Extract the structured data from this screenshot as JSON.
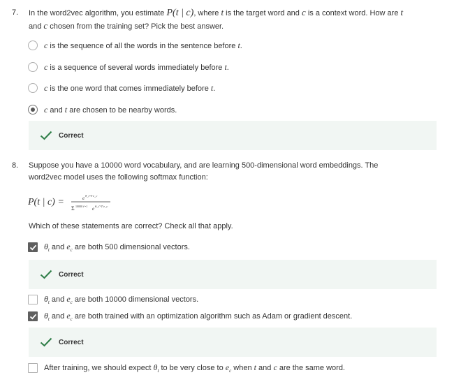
{
  "q7": {
    "number": "7.",
    "text_a": "In the word2vec algorithm, you estimate ",
    "text_math": "P(t | c)",
    "text_b": ", where ",
    "t1": "t",
    "text_c": " is the target word and ",
    "c1": "c",
    "text_d": " is a context word. How are ",
    "t2": "t",
    "text_e": "and ",
    "c2": "c",
    "text_f": " chosen from the training set? Pick the best answer.",
    "options": [
      {
        "pre": "c",
        "text": " is the sequence of all the words in the sentence before ",
        "post": "t",
        "end": "."
      },
      {
        "pre": "c",
        "text": " is a sequence of several words immediately before ",
        "post": "t",
        "end": "."
      },
      {
        "pre": "c",
        "text": " is the one word that comes immediately before ",
        "post": "t",
        "end": "."
      },
      {
        "pre": "c",
        "text": " and ",
        "post": "t",
        "end": " are chosen to be nearby words."
      }
    ],
    "feedback": "Correct"
  },
  "q8": {
    "number": "8.",
    "text_a": "Suppose you have a 10000 word vocabulary, and are learning 500-dimensional word embeddings. The",
    "text_b": "word2vec model uses the following softmax function:",
    "formula_lhs": "P(t | c) =",
    "formula_num": "e",
    "formula_num_sup": "θ_t^T e_c",
    "formula_den": "Σ",
    "formula_den_limits": "10000 t′=1",
    "formula_den_e": "e",
    "formula_den_sup": "θ_t′^T e_c",
    "prompt": "Which of these statements are correct? Check all that apply.",
    "options": [
      {
        "theta": "θ",
        "tsub": "t",
        "and": " and ",
        "e": "e",
        "csub": "c",
        "rest": " are both 500 dimensional vectors."
      },
      {
        "theta": "θ",
        "tsub": "t",
        "and": " and ",
        "e": "e",
        "csub": "c",
        "rest": " are both 10000 dimensional vectors."
      },
      {
        "theta": "θ",
        "tsub": "t",
        "and": " and ",
        "e": "e",
        "csub": "c",
        "rest": " are both trained with an optimization algorithm such as Adam or gradient descent."
      },
      {
        "pre": "After training, we should expect ",
        "theta": "θ",
        "tsub": "t",
        "mid": " to be very close to ",
        "e": "e",
        "csub": "c",
        "mid2": " when ",
        "t": "t",
        "and": " and ",
        "c": "c",
        "rest": " are the same word."
      }
    ],
    "feedback_1": "Correct",
    "feedback_2": "Correct"
  },
  "colors": {
    "feedback_bg": "#f1f6f3",
    "correct_check": "#2d7d46",
    "checkbox_checked": "#5f5f5f"
  }
}
